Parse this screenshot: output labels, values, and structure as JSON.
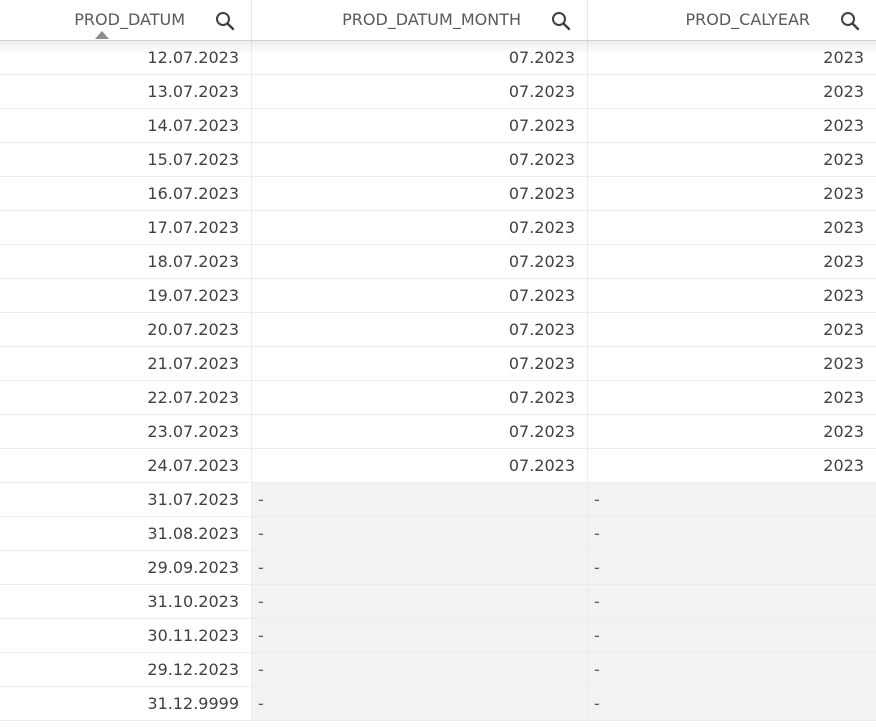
{
  "columns": [
    {
      "label": "PROD_DATUM",
      "sorted": "ascending"
    },
    {
      "label": "PROD_DATUM_MONTH"
    },
    {
      "label": "PROD_CALYEAR"
    }
  ],
  "icons": {
    "search": "search-icon",
    "sort": "sort-ascending-icon"
  },
  "null_placeholder": "-",
  "colors": {
    "null_fill": "#f2f2f2",
    "grid": "#ececec",
    "text": "#404040"
  },
  "rows": [
    {
      "prod_datum": "12.07.2023",
      "prod_datum_month": "07.2023",
      "prod_calyear": "2023"
    },
    {
      "prod_datum": "13.07.2023",
      "prod_datum_month": "07.2023",
      "prod_calyear": "2023"
    },
    {
      "prod_datum": "14.07.2023",
      "prod_datum_month": "07.2023",
      "prod_calyear": "2023"
    },
    {
      "prod_datum": "15.07.2023",
      "prod_datum_month": "07.2023",
      "prod_calyear": "2023"
    },
    {
      "prod_datum": "16.07.2023",
      "prod_datum_month": "07.2023",
      "prod_calyear": "2023"
    },
    {
      "prod_datum": "17.07.2023",
      "prod_datum_month": "07.2023",
      "prod_calyear": "2023"
    },
    {
      "prod_datum": "18.07.2023",
      "prod_datum_month": "07.2023",
      "prod_calyear": "2023"
    },
    {
      "prod_datum": "19.07.2023",
      "prod_datum_month": "07.2023",
      "prod_calyear": "2023"
    },
    {
      "prod_datum": "20.07.2023",
      "prod_datum_month": "07.2023",
      "prod_calyear": "2023"
    },
    {
      "prod_datum": "21.07.2023",
      "prod_datum_month": "07.2023",
      "prod_calyear": "2023"
    },
    {
      "prod_datum": "22.07.2023",
      "prod_datum_month": "07.2023",
      "prod_calyear": "2023"
    },
    {
      "prod_datum": "23.07.2023",
      "prod_datum_month": "07.2023",
      "prod_calyear": "2023"
    },
    {
      "prod_datum": "24.07.2023",
      "prod_datum_month": "07.2023",
      "prod_calyear": "2023"
    },
    {
      "prod_datum": "31.07.2023",
      "prod_datum_month": "-",
      "prod_calyear": "-"
    },
    {
      "prod_datum": "31.08.2023",
      "prod_datum_month": "-",
      "prod_calyear": "-"
    },
    {
      "prod_datum": "29.09.2023",
      "prod_datum_month": "-",
      "prod_calyear": "-"
    },
    {
      "prod_datum": "31.10.2023",
      "prod_datum_month": "-",
      "prod_calyear": "-"
    },
    {
      "prod_datum": "30.11.2023",
      "prod_datum_month": "-",
      "prod_calyear": "-"
    },
    {
      "prod_datum": "29.12.2023",
      "prod_datum_month": "-",
      "prod_calyear": "-"
    },
    {
      "prod_datum": "31.12.9999",
      "prod_datum_month": "-",
      "prod_calyear": "-"
    }
  ]
}
